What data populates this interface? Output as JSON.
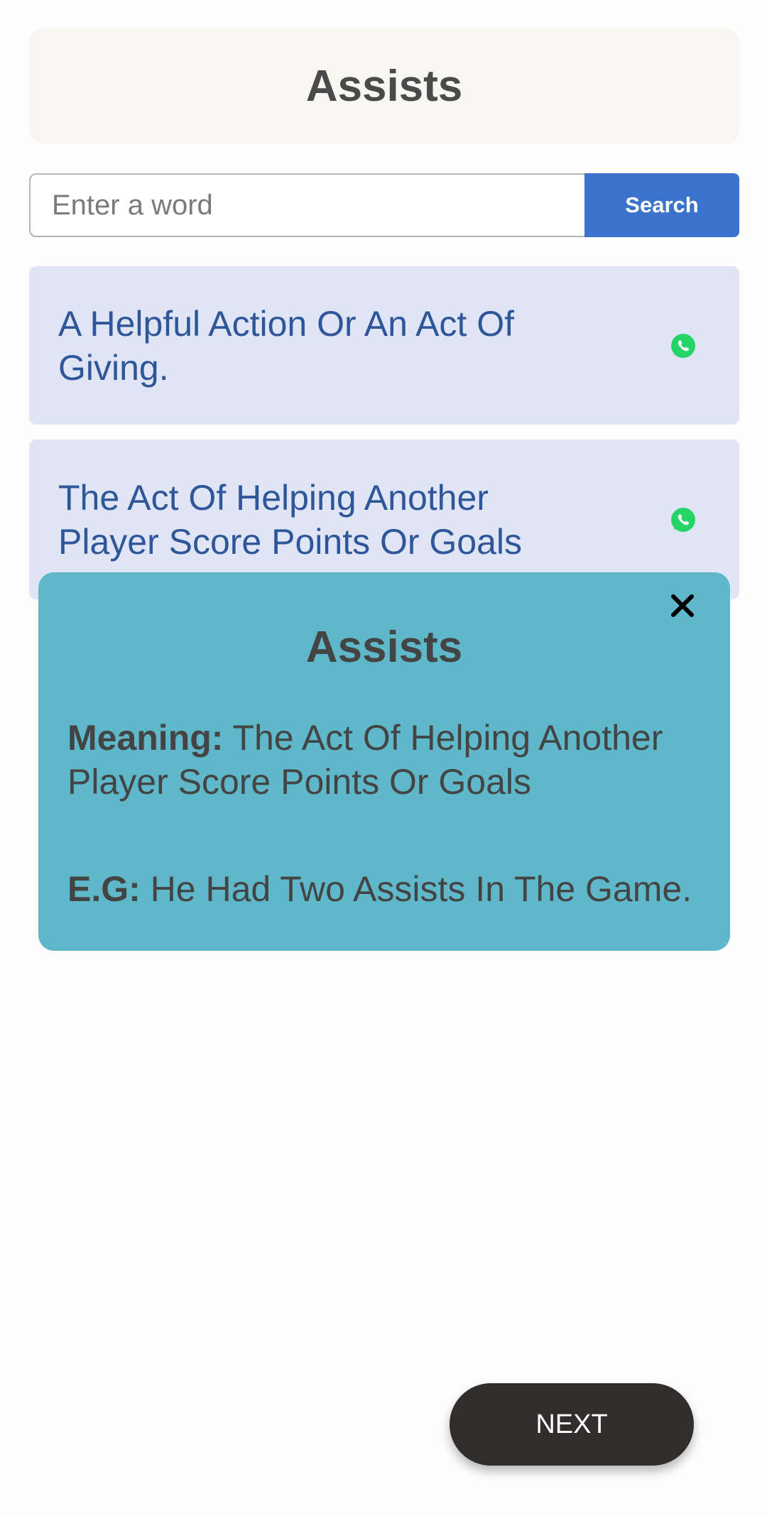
{
  "header": {
    "title": "Assists"
  },
  "search": {
    "placeholder": "Enter a word",
    "button_label": "Search"
  },
  "results": [
    {
      "text": "A Helpful Action Or An Act Of Giving.",
      "share_icon": "whatsapp-icon"
    },
    {
      "text": "The Act Of Helping Another Player Score Points Or Goals",
      "share_icon": "whatsapp-icon"
    }
  ],
  "modal": {
    "title": "Assists",
    "meaning_label": "Meaning:",
    "meaning_text": "The Act Of Helping Another Player Score Points Or Goals",
    "example_label": "E.G:",
    "example_text": "He Had Two Assists In The Game.",
    "close_icon": "close-icon"
  },
  "footer": {
    "next_label": "NEXT"
  },
  "colors": {
    "header_bg": "#f8f6f0",
    "search_button": "#3a72cc",
    "card_bg": "#dfe5f5",
    "card_text": "#2e5699",
    "modal_bg": "#5fb8ca",
    "whatsapp": "#25d366",
    "next_button": "#322d2d"
  }
}
